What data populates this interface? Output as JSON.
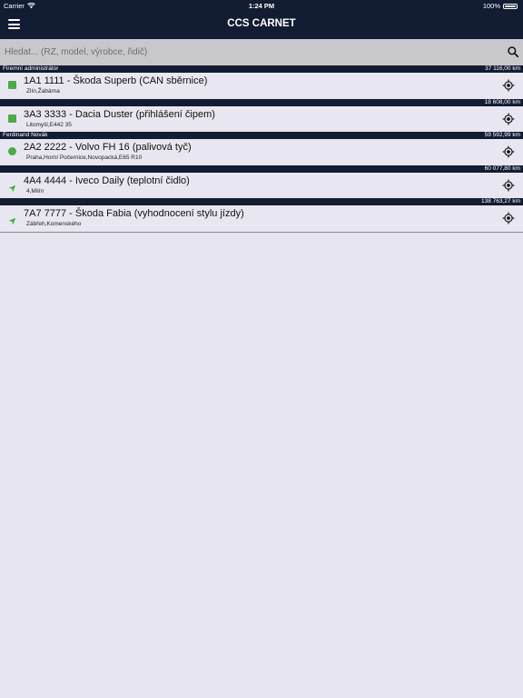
{
  "status_bar": {
    "carrier": "Carrier",
    "time": "1:24 PM",
    "battery": "100%"
  },
  "nav": {
    "title": "CCS CARNET"
  },
  "search": {
    "placeholder": "Hledat... (RZ, model, výrobce, řidič)"
  },
  "colors": {
    "bar_bg": "#121c33",
    "status_green": "#4bab48",
    "list_bg": "#e5e4ef"
  },
  "groups": [
    {
      "name": "Firemní administrátor",
      "km": "37 116,00 km",
      "vehicle": {
        "status": "square",
        "name": "1A1 1111 - Škoda Superb (CAN sběrnice)",
        "address": "Zlín,Žabárna"
      }
    },
    {
      "name": "",
      "km": "18 608,00 km",
      "vehicle": {
        "status": "square",
        "name": "3A3 3333 - Dacia Duster (přihlášení čipem)",
        "address": "Litomyšl,E442 35"
      }
    },
    {
      "name": "Ferdinand Novák",
      "km": "59 592,99 km",
      "vehicle": {
        "status": "dot",
        "name": "2A2 2222 - Volvo FH 16 (palivová tyč)",
        "address": "Praha,Horní Počernice,Novopacká,E65 R10"
      }
    },
    {
      "name": "",
      "km": "60 077,80 km",
      "vehicle": {
        "status": "arrow",
        "name": "4A4 4444 - Iveco Daily (teplotní čidlo)",
        "address": "4,Milín"
      }
    },
    {
      "name": "",
      "km": "138 763,27 km",
      "vehicle": {
        "status": "arrow",
        "name": "7A7 7777 - Škoda Fabia (vyhodnocení stylu jízdy)",
        "address": "Zábřeh,Komenského"
      }
    }
  ]
}
